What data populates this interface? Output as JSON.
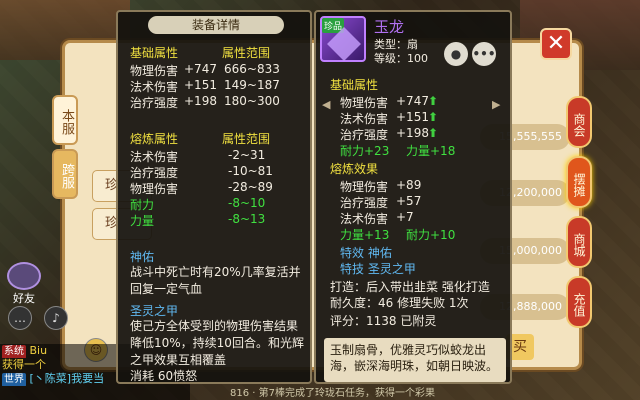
{
  "shop": {
    "tabs_left": [
      "本服",
      "跨服"
    ],
    "rows": [
      "珍",
      "珍"
    ],
    "buy_label": "买",
    "prices": [
      "15,555,555",
      "12,345,678",
      "12,200,000",
      "12,988,000",
      "15,000,000",
      "12,888,000"
    ]
  },
  "side_tabs": [
    "商会",
    "摆摊",
    "商城",
    "充值"
  ],
  "friends_label": "好友",
  "chat": {
    "line1_prefix": "系统",
    "line1_text": "Biu",
    "line2_text": "获得一个",
    "line3_chip": "世界",
    "line3_text": "[丶陈菜]我要当",
    "bottom_note": "816 · 第7棒完成了玲珑石任务，获得一个彩果"
  },
  "detail": {
    "title": "装备详情",
    "base": {
      "header_attr": "基础属性",
      "header_range": "属性范围",
      "rows": [
        {
          "name": "物理伤害",
          "value": "+747",
          "range": "666~833"
        },
        {
          "name": "法术伤害",
          "value": "+151",
          "range": "149~187"
        },
        {
          "name": "治疗强度",
          "value": "+198",
          "range": "180~300"
        }
      ]
    },
    "refine": {
      "header_attr": "熔炼属性",
      "header_range": "属性范围",
      "rows": [
        {
          "name": "法术伤害",
          "range": "-2~31"
        },
        {
          "name": "治疗强度",
          "range": "-10~81"
        },
        {
          "name": "物理伤害",
          "range": "-28~89"
        },
        {
          "name": "耐力",
          "range": "-8~10"
        },
        {
          "name": "力量",
          "range": "-8~13"
        }
      ]
    },
    "skill1": {
      "name": "神佑",
      "text": "战斗中死亡时有20%几率复活并回复一定气血"
    },
    "skill2": {
      "name": "圣灵之甲",
      "text": "使己方全体受到的物理伤害结果降低10%，持续10回合。和光辉之甲效果互相覆盖",
      "cost": "消耗  60愤怒"
    }
  },
  "item": {
    "tag": "珍品",
    "name": "玉龙",
    "type": "类型：扇",
    "level": "等级：100",
    "eye_icon": "●",
    "more_icon": "•••",
    "base_header": "基础属性",
    "base_rows": [
      {
        "name": "物理伤害",
        "value": "+747"
      },
      {
        "name": "法术伤害",
        "value": "+151"
      },
      {
        "name": "治疗强度",
        "value": "+198"
      }
    ],
    "green1a": "耐力+23",
    "green1b": "力量+18",
    "refine_header": "熔炼效果",
    "refine_rows": [
      {
        "name": "物理伤害",
        "value": "+89"
      },
      {
        "name": "治疗强度",
        "value": "+57"
      },
      {
        "name": "法术伤害",
        "value": "+7"
      }
    ],
    "green2a": "力量+13",
    "green2b": "耐力+10",
    "special": "特效  神佑",
    "special_skill": "特技  圣灵之甲",
    "forge": "打造：后入带出韭菜  强化打造",
    "durability": "耐久度：46  修理失败 1次",
    "score": "评分：1138    已附灵",
    "lore": "玉制扇骨，优雅灵巧似蛟龙出海，嵌深海明珠，如朝日映波。"
  }
}
